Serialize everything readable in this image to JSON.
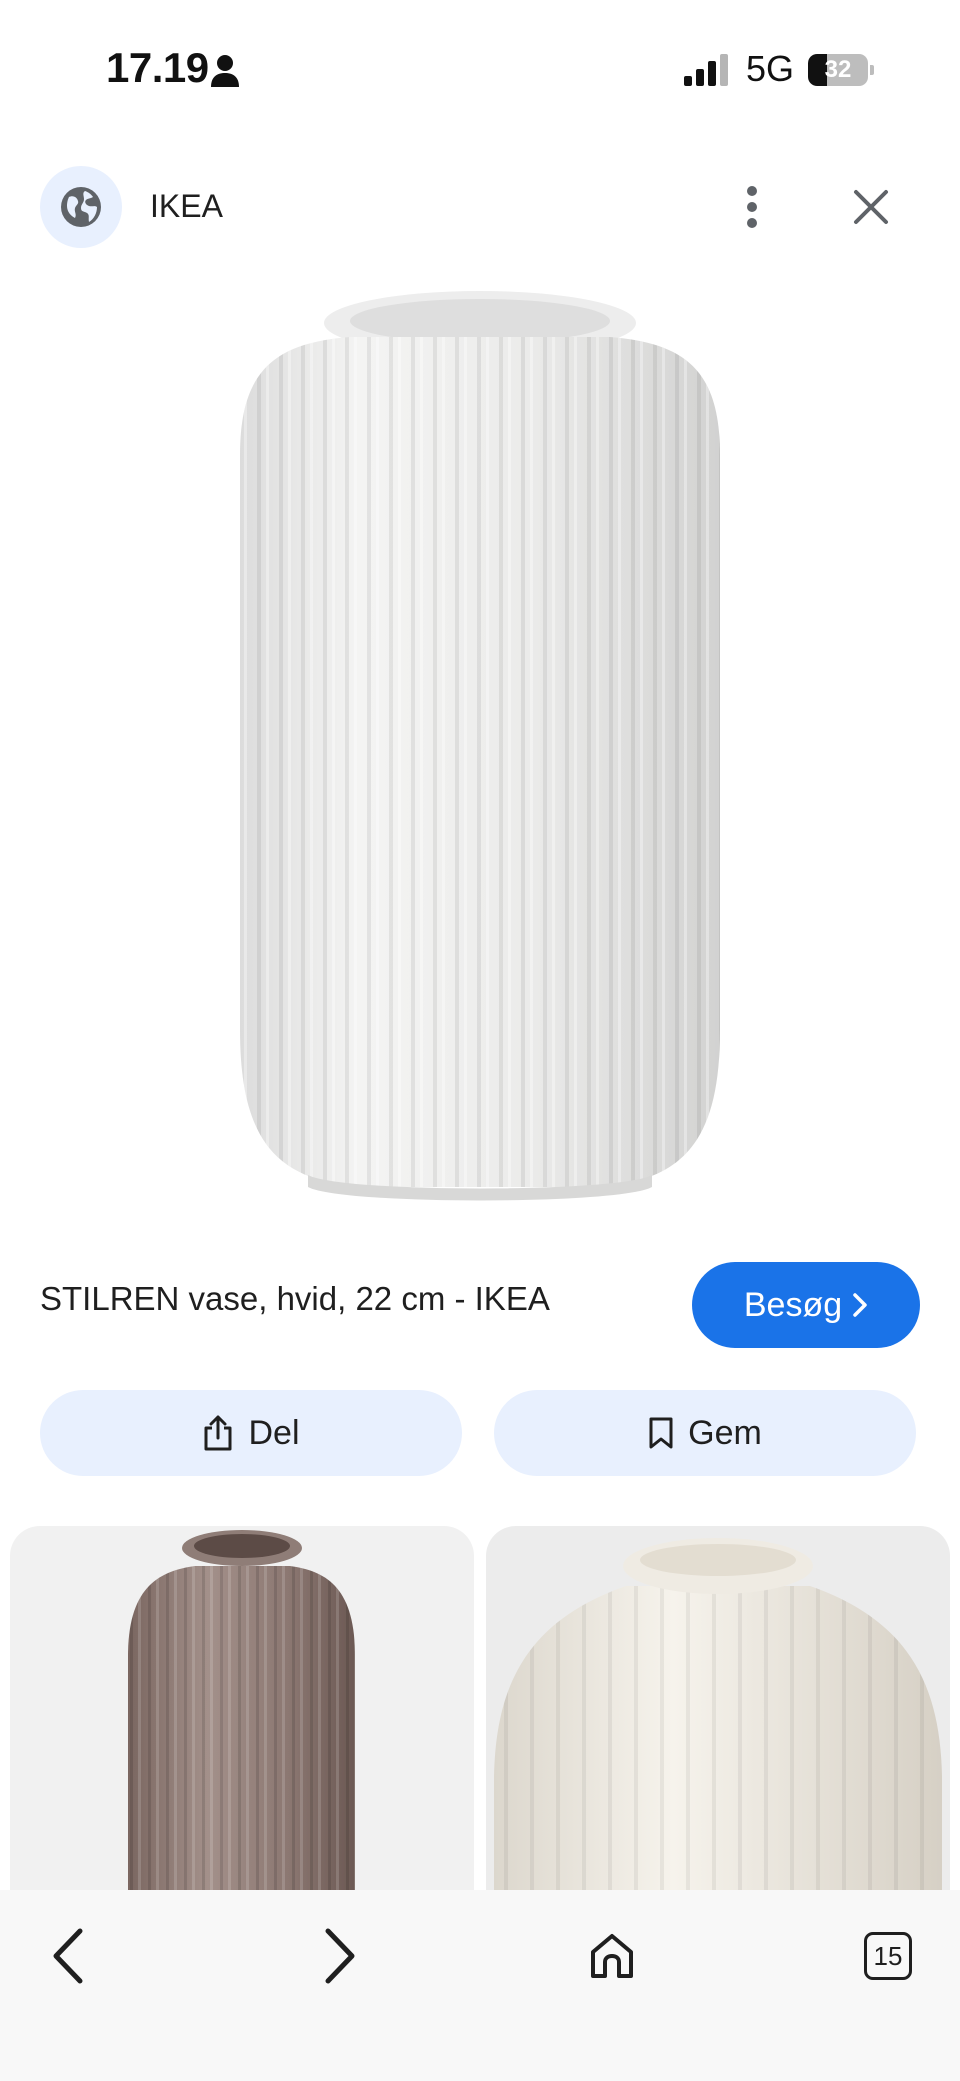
{
  "status_bar": {
    "time": "17.19",
    "network": "5G",
    "battery_level": "32",
    "battery_fraction": 0.32
  },
  "header": {
    "site_name": "IKEA",
    "site_icon": "globe-icon",
    "more_icon": "more-vertical-icon",
    "close_icon": "close-icon"
  },
  "result": {
    "title": "STILREN vase, hvid, 22 cm - IKEA",
    "visit_label": "Besøg"
  },
  "actions": {
    "share_label": "Del",
    "save_label": "Gem"
  },
  "bottom_nav": {
    "back_icon": "chevron-left-icon",
    "forward_icon": "chevron-right-icon",
    "home_icon": "home-icon",
    "tab_count": "15"
  },
  "colors": {
    "accent": "#1a73e8",
    "chip_background": "#e8f0fe"
  }
}
